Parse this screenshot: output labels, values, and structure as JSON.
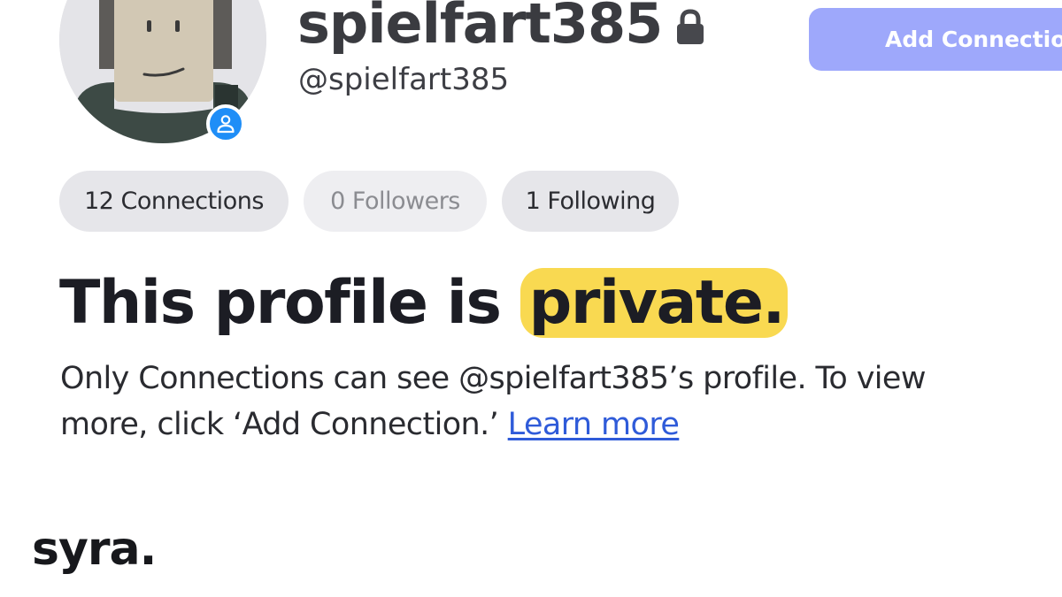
{
  "profile": {
    "display_name": "spielfart385",
    "username": "@spielfart385",
    "avatar_icon": "avatar-image",
    "badge_icon": "user-icon",
    "lock_icon": "lock-icon"
  },
  "actions": {
    "add_connection_label": "Add Connection"
  },
  "stats": {
    "connections": "12 Connections",
    "followers": "0 Followers",
    "following": "1 Following"
  },
  "private_notice": {
    "headline_prefix": "This profile is ",
    "headline_highlight": "private.",
    "description": "Only Connections can see @spielfart385’s profile. To view more, click ‘Add Connection.’ ",
    "learn_more": "Learn more"
  },
  "branding": {
    "logo": "syra."
  },
  "colors": {
    "primary_button": "#9ea8fb",
    "highlight": "#f9d951",
    "link": "#2f5bd9",
    "badge": "#1f8ef7"
  }
}
